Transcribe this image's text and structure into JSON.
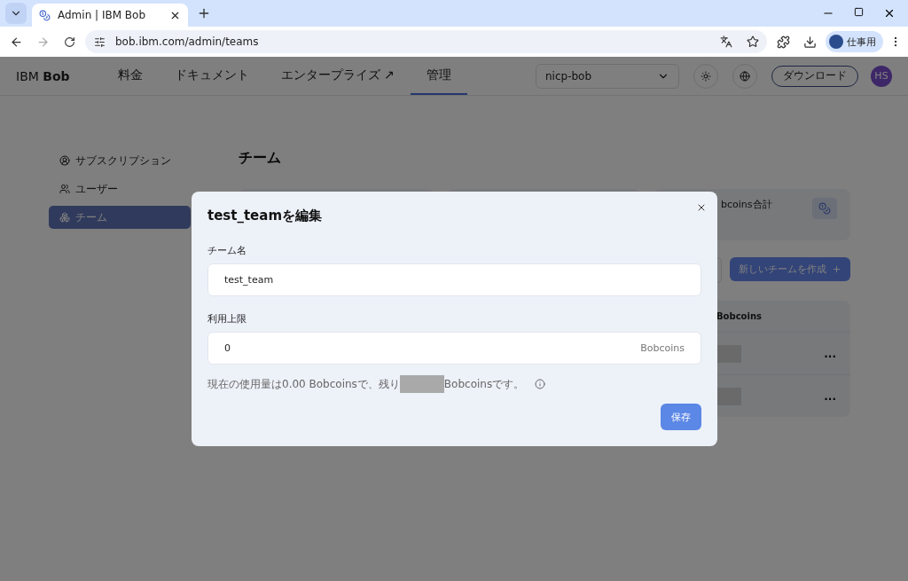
{
  "browser": {
    "tab_title": "Admin | IBM Bob",
    "url": "bob.ibm.com/admin/teams",
    "profile_label": "仕事用"
  },
  "app_header": {
    "logo": "IBM **Bob**",
    "nav": [
      {
        "label": "料金",
        "selected": false
      },
      {
        "label": "ドキュメント",
        "selected": false
      },
      {
        "label": "エンタープライズ ↗",
        "selected": false
      },
      {
        "label": "管理",
        "selected": true
      }
    ],
    "org_select": {
      "value": "nicp-bob"
    },
    "download_button": "ダウンロード",
    "avatar": "HS"
  },
  "sidebar": {
    "items": [
      {
        "label": "サブスクリプション",
        "selected": false
      },
      {
        "label": "ユーザー",
        "selected": false
      },
      {
        "label": "チーム",
        "selected": true
      }
    ]
  },
  "page": {
    "title": "チーム",
    "stat_card": {
      "label": "bcoins合計"
    },
    "create_button": "新しいチームを作成",
    "table": {
      "column_header": "Bobcoins",
      "rows": [
        {
          "menu": "..."
        },
        {
          "menu": "..."
        }
      ]
    }
  },
  "modal": {
    "title": "test_teamを編集",
    "fields": [
      {
        "label": "チーム名",
        "value": "test_team"
      },
      {
        "label": "利用上限",
        "value": "0",
        "suffix": "Bobcoins"
      }
    ],
    "note_before": "現在の使用量は0.00 Bobcoinsで、残り",
    "note_after": "Bobcoinsです。",
    "save_button": "保存"
  }
}
